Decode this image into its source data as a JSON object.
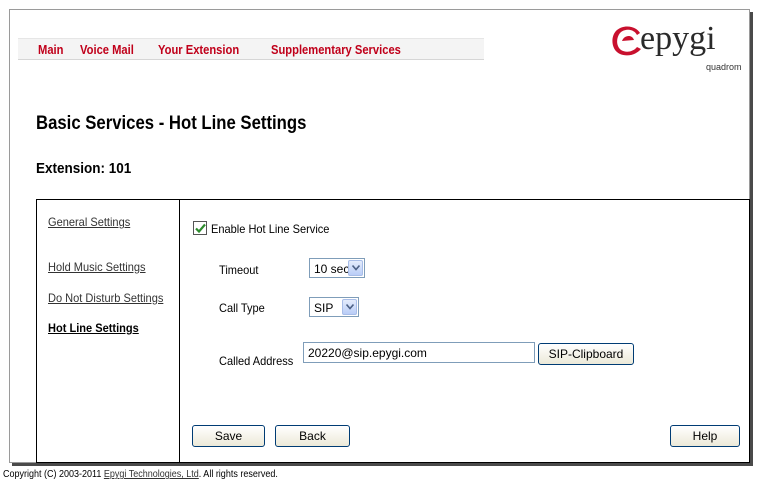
{
  "menu": {
    "items": [
      {
        "label": "Main"
      },
      {
        "label": "Voice Mail"
      },
      {
        "label": "Your Extension"
      },
      {
        "label": "Supplementary Services"
      }
    ]
  },
  "logo": {
    "text": "epygi",
    "subtext": "quadrom",
    "color": "#c8102e"
  },
  "page": {
    "title": "Basic Services - Hot Line Settings",
    "extension_label": "Extension: 101"
  },
  "sidebar": {
    "items": [
      {
        "label": "General Settings",
        "active": false
      },
      {
        "label": "Hold Music Settings",
        "active": false
      },
      {
        "label": "Do Not Disturb Settings",
        "active": false
      },
      {
        "label": "Hot Line Settings",
        "active": true
      }
    ]
  },
  "form": {
    "enable_label": "Enable Hot Line Service",
    "enable_checked": true,
    "timeout_label": "Timeout",
    "timeout_value": "10 sec",
    "call_type_label": "Call Type",
    "call_type_value": "SIP",
    "called_address_label": "Called Address",
    "called_address_value": "20220@sip.epygi.com",
    "clipboard_button": "SIP-Clipboard"
  },
  "actions": {
    "save": "Save",
    "back": "Back",
    "help": "Help"
  },
  "footer": {
    "prefix": "Copyright (C) 2003-2011 ",
    "company": "Epygi Technologies, Ltd",
    "suffix": ". All rights reserved."
  },
  "colors": {
    "menu_text": "#c0001a",
    "check": "#2e8b2e",
    "input_border": "#7f9db9"
  }
}
